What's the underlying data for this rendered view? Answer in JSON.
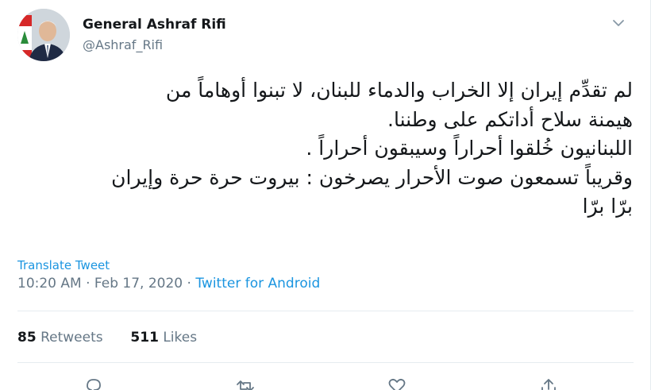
{
  "author": {
    "display_name": "General Ashraf Rifi",
    "handle": "@Ashraf_Rifi",
    "avatar_icon": "profile-photo"
  },
  "tweet": {
    "lines": [
      "لم تقدِّم إيران إلا الخراب والدماء للبنان، لا تبنوا أوهاماً من",
      "هيمنة سلاح أداتكم على وطننا.",
      "اللبنانيون خُلقوا أحراراً وسيبقون أحراراً .",
      "وقريباً تسمعون صوت الأحرار يصرخون : بيروت حرة حرة وإيران",
      "برّا برّا"
    ],
    "translate_label": "Translate Tweet",
    "time": "10:20 AM",
    "separator": "·",
    "date": "Feb 17, 2020",
    "source": "Twitter for Android"
  },
  "stats": {
    "retweets_count": "85",
    "retweets_label": "Retweets",
    "likes_count": "511",
    "likes_label": "Likes"
  },
  "icons": {
    "caret": "chevron-down-icon",
    "reply": "reply-icon",
    "retweet": "retweet-icon",
    "like": "heart-icon",
    "share": "share-icon"
  },
  "colors": {
    "link": "#1b95e0",
    "secondary_text": "#657786",
    "primary_text": "#14171a",
    "divider": "#e6ecf0"
  }
}
